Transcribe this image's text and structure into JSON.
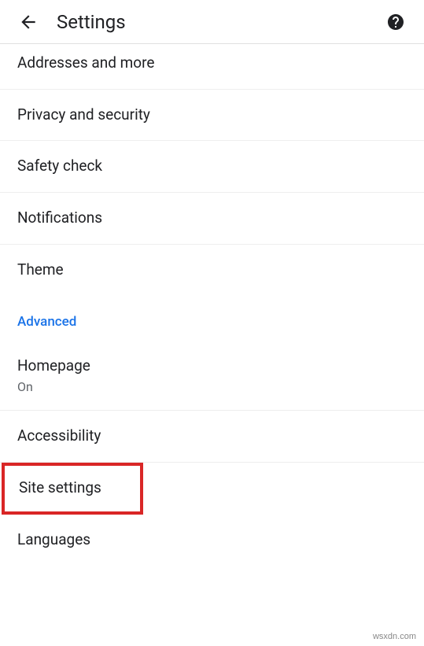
{
  "header": {
    "title": "Settings"
  },
  "items": {
    "addresses": {
      "label": "Addresses and more"
    },
    "privacy": {
      "label": "Privacy and security"
    },
    "safety": {
      "label": "Safety check"
    },
    "notifications": {
      "label": "Notifications"
    },
    "theme": {
      "label": "Theme"
    }
  },
  "section": {
    "advanced": "Advanced"
  },
  "advanced_items": {
    "homepage": {
      "label": "Homepage",
      "sub": "On"
    },
    "accessibility": {
      "label": "Accessibility"
    },
    "site_settings": {
      "label": "Site settings"
    },
    "languages": {
      "label": "Languages"
    }
  },
  "watermark": "wsxdn.com"
}
